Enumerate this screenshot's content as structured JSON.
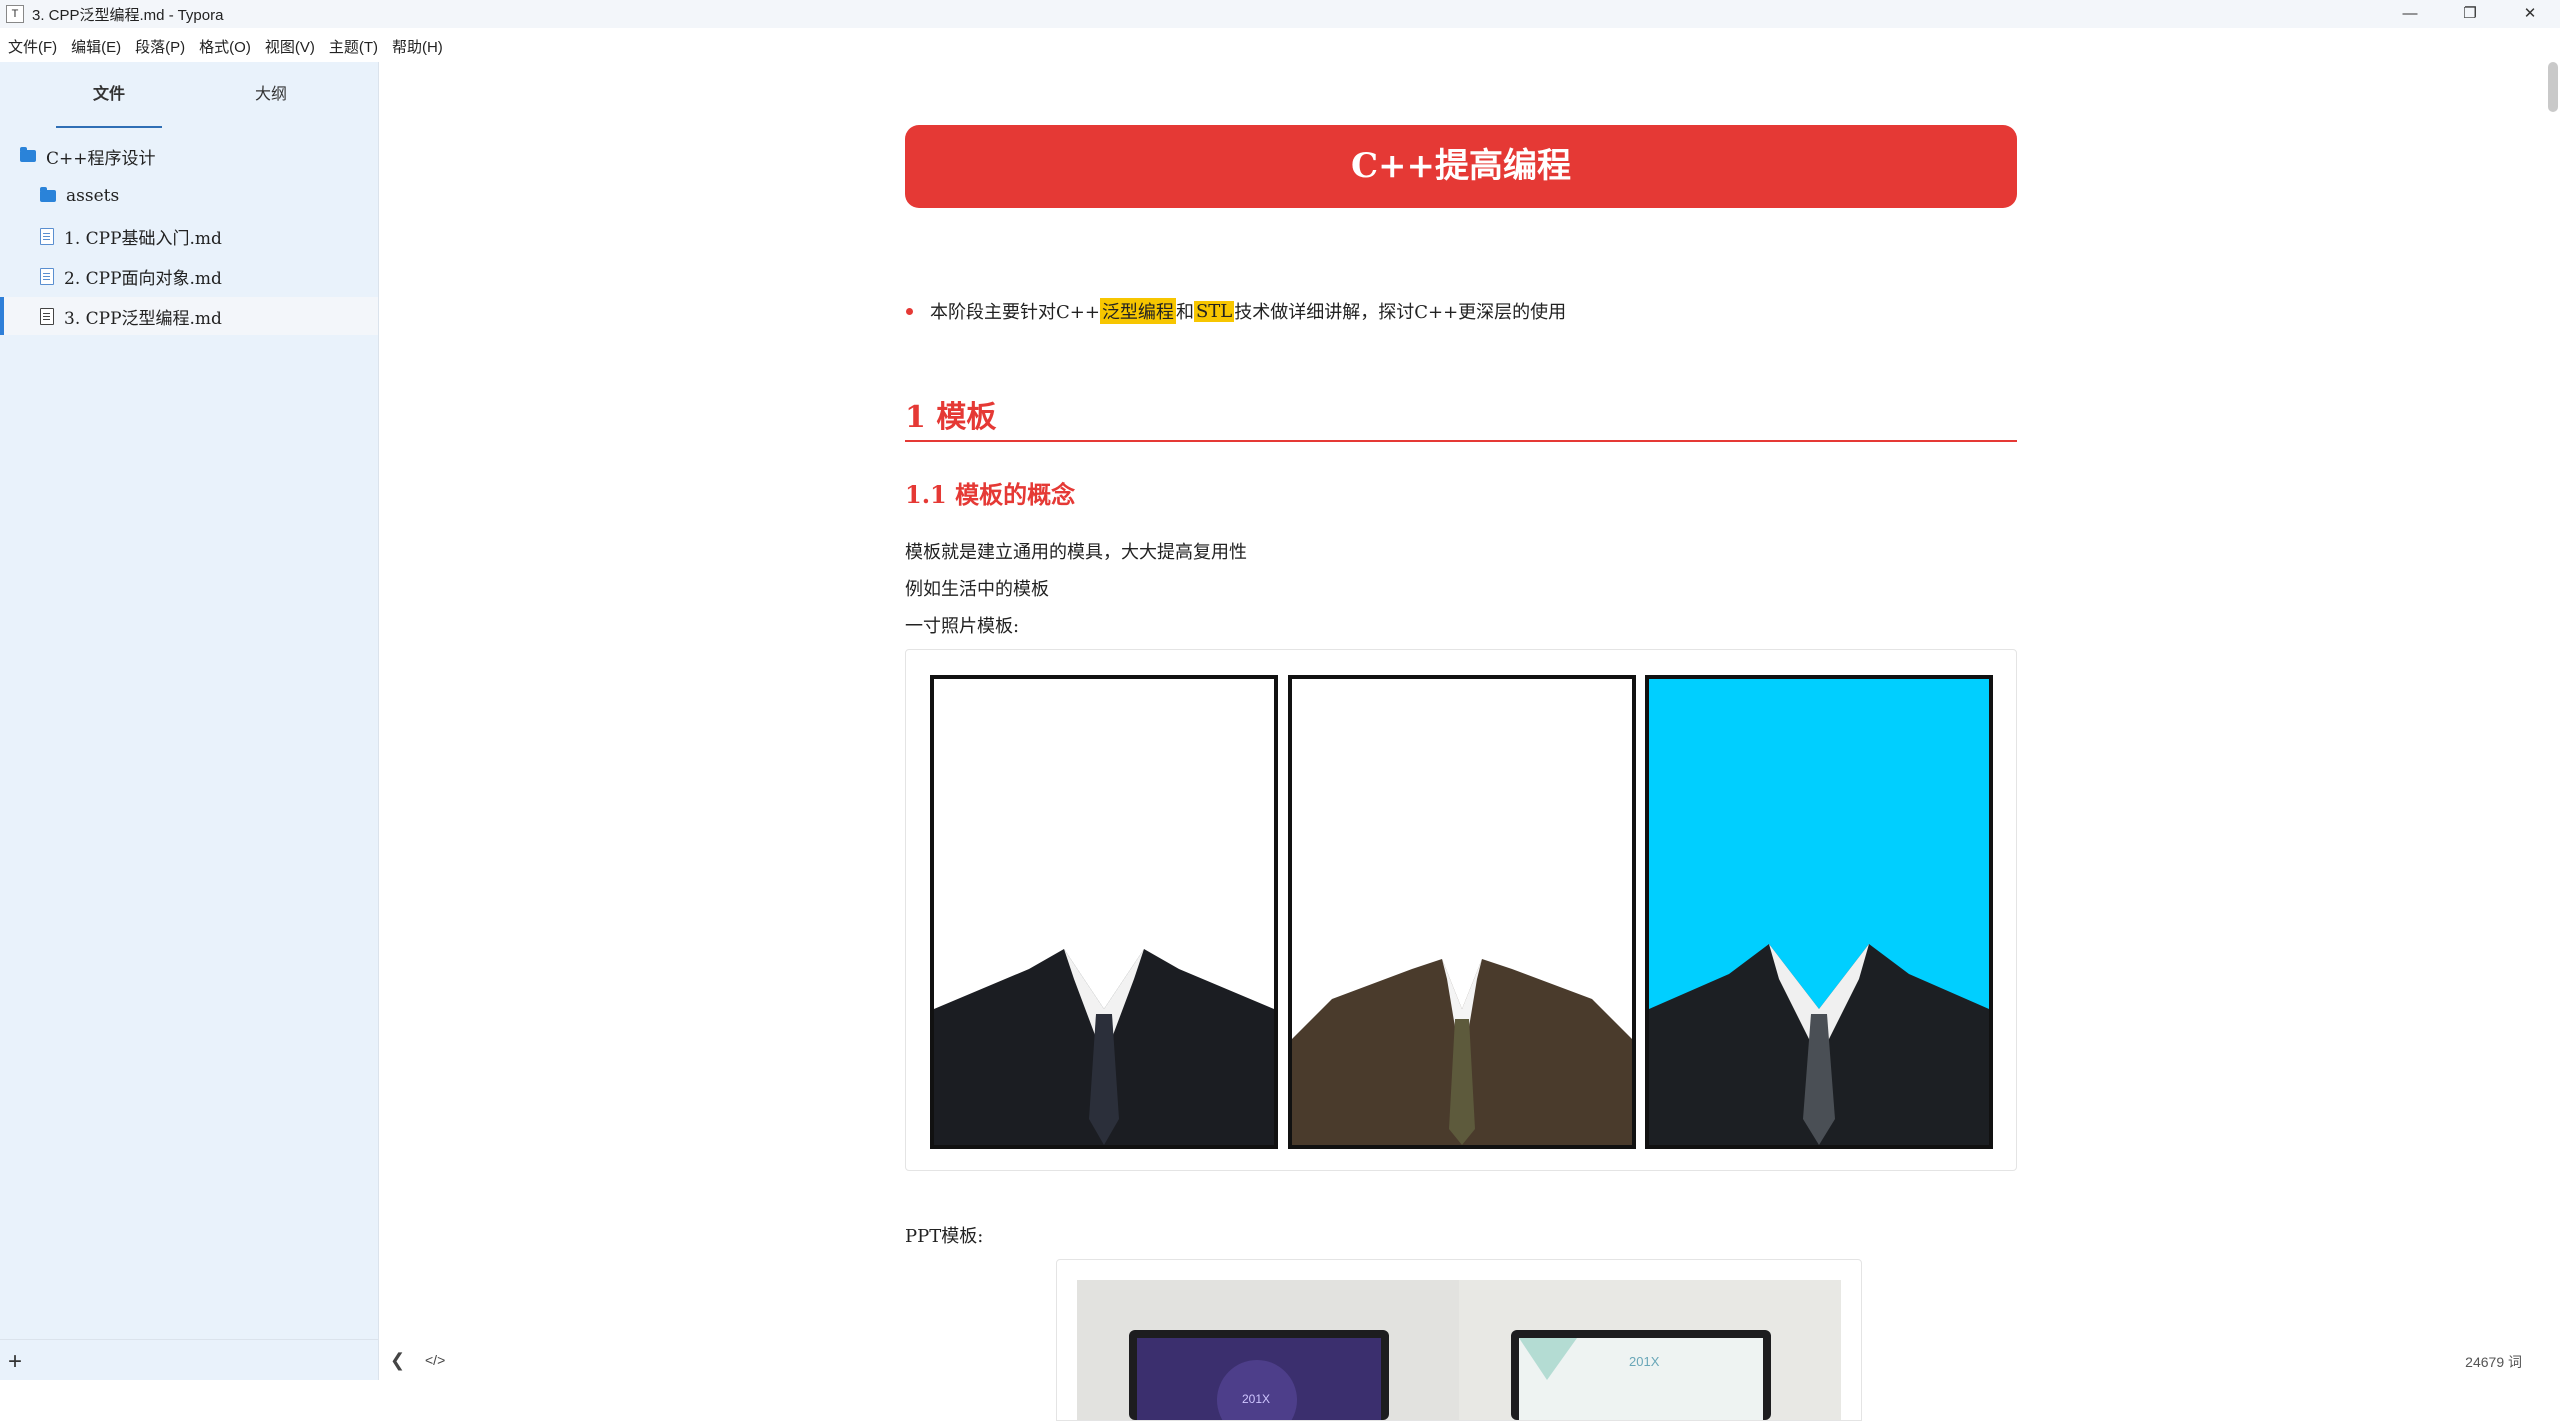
{
  "window": {
    "app_icon_letter": "T",
    "title": "3. CPP泛型编程.md - Typora",
    "minimize_symbol": "—",
    "restore_symbol": "❐",
    "close_symbol": "✕"
  },
  "menubar": {
    "items": [
      "文件(F)",
      "编辑(E)",
      "段落(P)",
      "格式(O)",
      "视图(V)",
      "主题(T)",
      "帮助(H)"
    ]
  },
  "sidebar": {
    "tabs": [
      {
        "label": "文件",
        "active": true
      },
      {
        "label": "大纲",
        "active": false
      }
    ],
    "tree": [
      {
        "label": "C++程序设计",
        "type": "folder",
        "icon": "folder-icon"
      },
      {
        "label": "assets",
        "type": "folder",
        "icon": "folder-icon"
      },
      {
        "label": "1. CPP基础入门.md",
        "type": "file",
        "icon": "file-icon"
      },
      {
        "label": "2. CPP面向对象.md",
        "type": "file",
        "icon": "file-icon"
      },
      {
        "label": "3. CPP泛型编程.md",
        "type": "file",
        "icon": "file-icon",
        "active": true
      }
    ],
    "add_symbol": "+"
  },
  "document": {
    "banner_title": "C++提高编程",
    "intro": {
      "prefix": "本阶段主要针对C++",
      "highlight1": "泛型编程",
      "middle": "和",
      "highlight2": "STL",
      "suffix": "技术做详细讲解，探讨C++更深层的使用"
    },
    "h1": "1 模板",
    "h2": "1.1 模板的概念",
    "paragraphs": [
      "模板就是建立通用的模具，大大提高复用性",
      "例如生活中的模板",
      "一寸照片模板:"
    ],
    "ppt_label": "PPT模板:",
    "ppt_slide_texts": [
      "201X",
      "201X"
    ]
  },
  "footer": {
    "back_symbol": "❮",
    "source_symbol": "</>",
    "word_count": "24679 词"
  },
  "colors": {
    "accent_red": "#e53935",
    "highlight_yellow": "#f7c600",
    "sidebar_bg": "#e9f2fb",
    "active_marker": "#2f7fd8",
    "photo3_bg": "#00cfff"
  }
}
